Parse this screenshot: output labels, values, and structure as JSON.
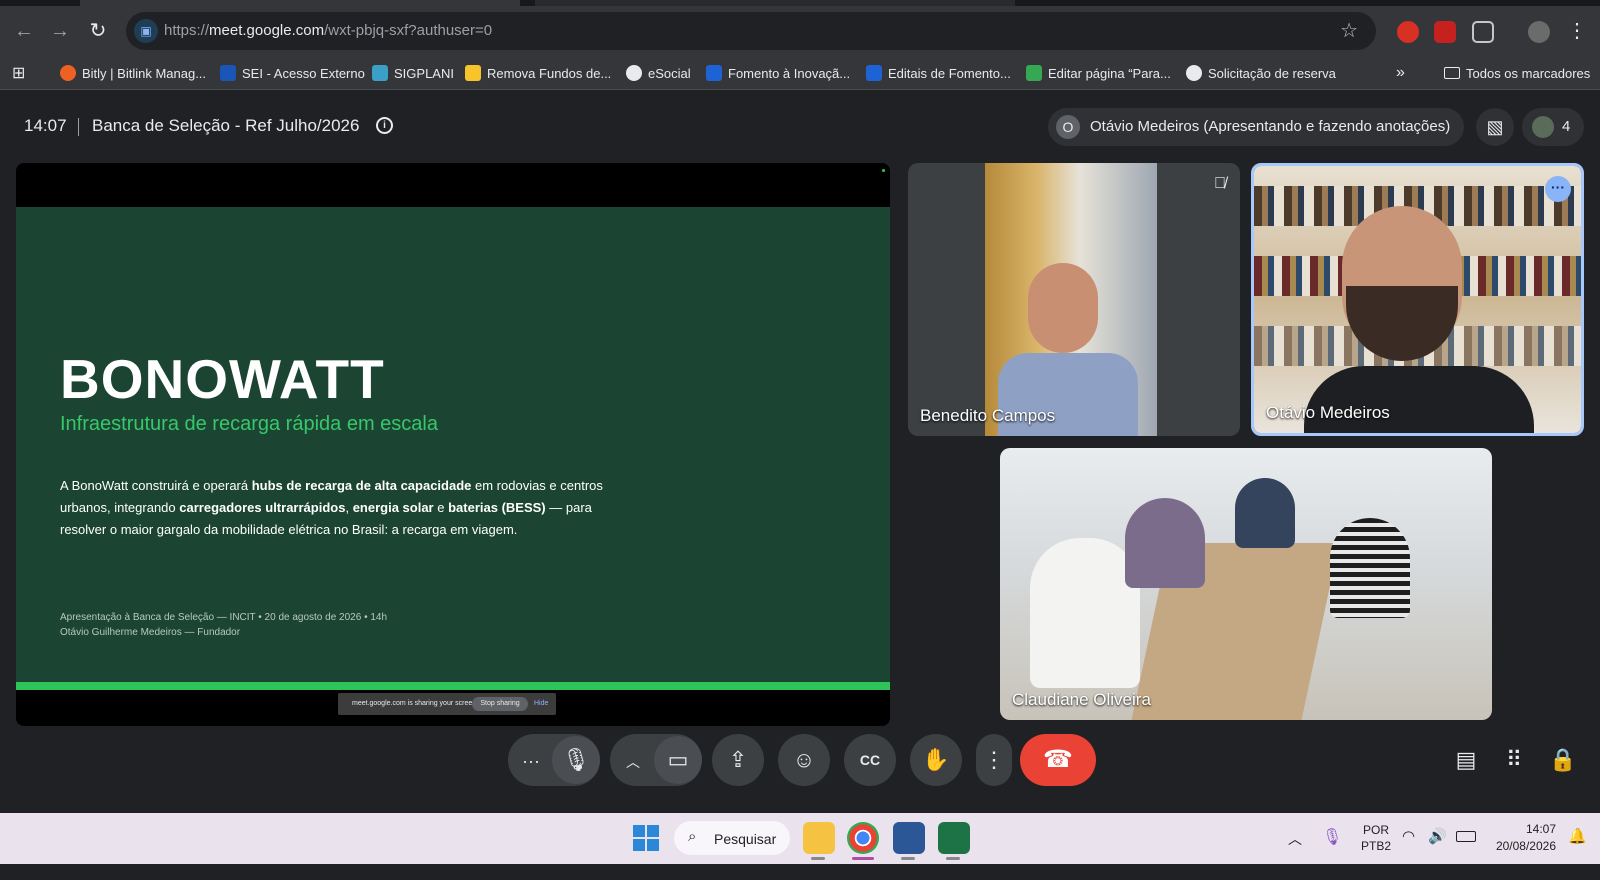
{
  "browser": {
    "url_prefix": "https://",
    "url_host": "meet.google.com",
    "url_path": "/wxt-pbjq-sxf?authuser=0",
    "bookmarks": [
      {
        "label": "Bitly | Bitlink Manag...",
        "color": "#ee6123"
      },
      {
        "label": "SEI - Acesso Externo",
        "color": "#1a56b8"
      },
      {
        "label": "SIGPLANI",
        "color": "#3aa0c8"
      },
      {
        "label": "Remova Fundos de...",
        "color": "#f7c52b"
      },
      {
        "label": "eSocial",
        "color": "#e8eaed"
      },
      {
        "label": "Fomento à Inovaçã...",
        "color": "#1e63d6"
      },
      {
        "label": "Editais de Fomento...",
        "color": "#1e63d6"
      },
      {
        "label": "Editar página “Para...",
        "color": "#34a853"
      },
      {
        "label": "Solicitação de reserva",
        "color": "#e8eaed"
      }
    ],
    "all_bookmarks": "Todos os marcadores"
  },
  "meet": {
    "time": "14:07",
    "title": "Banca de Seleção - Ref Julho/2026",
    "presenter_initial": "O",
    "presenter_text": "Otávio Medeiros (Apresentando e fazendo anotações)",
    "participant_count": "4",
    "slide": {
      "title": "BONOWATT",
      "subtitle": "Infraestrutura de recarga rápida em escala",
      "body_1": "A BonoWatt construirá e operará ",
      "body_b1": "hubs de recarga de alta capacidade",
      "body_2": " em rodovias e centros urbanos, integrando ",
      "body_b2": "carregadores ultrarrápidos",
      "body_3": ", ",
      "body_b3": "energia solar",
      "body_4": " e ",
      "body_b4": "baterias (BESS)",
      "body_5": " — para resolver o maior gargalo da mobilidade elétrica no Brasil: a recarga em viagem.",
      "footer_1": "Apresentação à Banca de Seleção — INCIT  •  20 de agosto de 2026  •  14h",
      "footer_2": "Otávio Guilherme Medeiros — Fundador"
    },
    "sharing_bar": {
      "message": "meet.google.com is sharing your screen.",
      "stop": "Stop sharing",
      "hide": "Hide"
    },
    "participants": [
      {
        "name": "Benedito Campos"
      },
      {
        "name": "Otávio Medeiros"
      },
      {
        "name": "Claudiane Oliveira"
      }
    ]
  },
  "taskbar": {
    "search": "Pesquisar",
    "lang_1": "POR",
    "lang_2": "PTB2",
    "time": "14:07",
    "date": "20/08/2026"
  }
}
